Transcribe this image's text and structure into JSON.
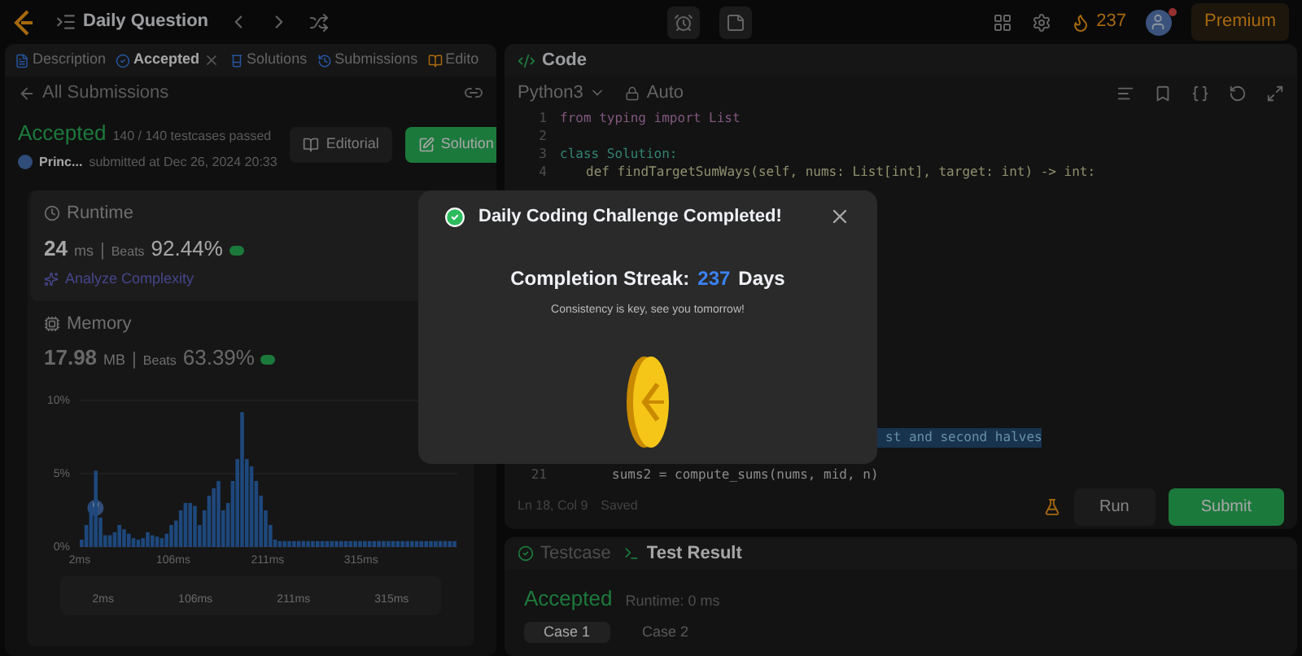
{
  "top_bar": {
    "title": "Daily Question",
    "streak": "237",
    "premium": "Premium",
    "has_notification": true
  },
  "left_panel": {
    "tabs": [
      {
        "label": "Description",
        "selected": false,
        "closable": false
      },
      {
        "label": "Accepted",
        "selected": true,
        "closable": true
      },
      {
        "label": "Solutions",
        "selected": false,
        "closable": false
      },
      {
        "label": "Submissions",
        "selected": false,
        "closable": false
      },
      {
        "label": "Edito",
        "selected": false,
        "closable": false
      }
    ],
    "back_link": "All Submissions",
    "status": "Accepted",
    "testcases": "140 / 140 testcases passed",
    "user": "Princ...",
    "submitted": "submitted at Dec 26, 2024 20:33",
    "buttons": [
      "Editorial",
      "Solution"
    ],
    "metrics": [
      {
        "title": "Runtime",
        "value": "24",
        "unit": "ms",
        "separator": "|",
        "beats_label": "Beats",
        "beats": "92.44%",
        "selected": true,
        "link": "Analyze Complexity"
      },
      {
        "title": "Memory",
        "value": "17.98",
        "unit": "MB",
        "separator": "|",
        "beats_label": "Beats",
        "beats": "63.39%",
        "selected": false
      }
    ],
    "chart_data": {
      "type": "bar",
      "x": [
        2,
        7.25,
        12.5,
        17.75,
        23,
        28.25,
        33.5,
        38.75,
        44,
        49.25,
        54.5,
        59.75,
        65,
        70.25,
        75.5,
        80.75,
        86,
        91.25,
        96.5,
        101.75,
        107,
        112.25,
        117.5,
        122.75,
        128,
        133.25,
        138.5,
        143.75,
        149,
        154.25,
        159.5,
        164.75,
        170,
        175.25,
        180.5,
        185.75,
        191,
        196.25,
        201.5,
        206.75,
        212,
        217.25,
        222.5,
        227.75,
        233,
        238.25,
        243.5,
        248.75,
        254,
        259.25,
        264.5,
        269.75,
        275,
        280.25,
        285.5,
        290.75,
        296,
        301.25,
        306.5,
        311.75,
        317,
        322.25,
        327.5,
        332.75,
        338,
        343.25,
        348.5,
        353.75,
        359,
        364.25,
        369.5,
        374.75,
        380,
        385.25,
        390.5,
        395.75,
        401,
        406.25,
        411.5,
        416.75
      ],
      "xlim": [
        2,
        422
      ],
      "ylim": [
        0,
        10
      ],
      "series": [
        {
          "color": "#2f6fbf",
          "values": [
            0.5,
            1.5,
            3,
            5.2,
            2,
            0.8,
            0.8,
            1,
            1.5,
            1.2,
            0.9,
            0.6,
            0.5,
            0.6,
            1,
            0.8,
            0.7,
            0.6,
            0.9,
            1.5,
            1.8,
            2.5,
            3,
            3,
            2.8,
            1.5,
            2.5,
            3.5,
            4,
            4.5,
            2.5,
            3,
            4.5,
            6,
            9.2,
            6,
            5.5,
            4.5,
            3.5,
            2.5,
            1.5,
            0.5,
            0.4,
            0.4,
            0.4,
            0.4,
            0.4,
            0.4,
            0.4,
            0.4,
            0.4,
            0.4,
            0.4,
            0.4,
            0.4,
            0.4,
            0.4,
            0.4,
            0.4,
            0.4,
            0.4,
            0.4,
            0.4,
            0.4,
            0.4,
            0.4,
            0.4,
            0.4,
            0.4,
            0.4,
            0.4,
            0.4,
            0.4,
            0.4,
            0.4,
            0.4,
            0.4,
            0.4,
            0.4,
            0.4
          ]
        }
      ],
      "xticks": [
        {
          "value": 2,
          "label": "2ms"
        },
        {
          "value": 106,
          "label": "106ms"
        },
        {
          "value": 211,
          "label": "211ms"
        },
        {
          "value": 315,
          "label": "315ms"
        }
      ],
      "yticks": [
        {
          "value": 0,
          "label": "0%"
        },
        {
          "value": 5,
          "label": "5%"
        },
        {
          "value": 10,
          "label": "10%"
        }
      ]
    },
    "minimap_labels": [
      "2ms",
      "106ms",
      "211ms",
      "315ms"
    ]
  },
  "code_panel": {
    "title": "Code",
    "language": "Python3",
    "mode": "Auto",
    "lines": [
      {
        "number": "1",
        "text": "from typing import List",
        "kind": "import"
      },
      {
        "number": "2",
        "kind": "blank"
      },
      {
        "number": "3",
        "text": "class Solution:",
        "kind": "class"
      },
      {
        "number": "4",
        "text": "def findTargetSumWays(self, nums: List[int], target: int) -> int:",
        "kind": "def"
      },
      {
        "text": "st and second halves",
        "kind": "highlight"
      },
      {
        "number": "21",
        "text": "sums2 = compute_sums(nums, mid, n)",
        "kind": "body"
      }
    ],
    "cursor": "Ln 18, Col 9",
    "saved": "Saved",
    "buttons": [
      "Run",
      "Submit"
    ]
  },
  "result_panel": {
    "tabs": [
      {
        "label": "Testcase",
        "selected": false
      },
      {
        "label": "Test Result",
        "selected": true
      }
    ],
    "status": "Accepted",
    "runtime": "Runtime: 0 ms",
    "cases": [
      {
        "label": "Case 1",
        "selected": true
      },
      {
        "label": "Case 2",
        "selected": false
      }
    ]
  },
  "modal": {
    "title": "Daily Coding Challenge Completed!",
    "streak_label": "Completion Streak:",
    "streak": "237",
    "streak_unit": "Days",
    "message": "Consistency is key, see you tomorrow!"
  }
}
